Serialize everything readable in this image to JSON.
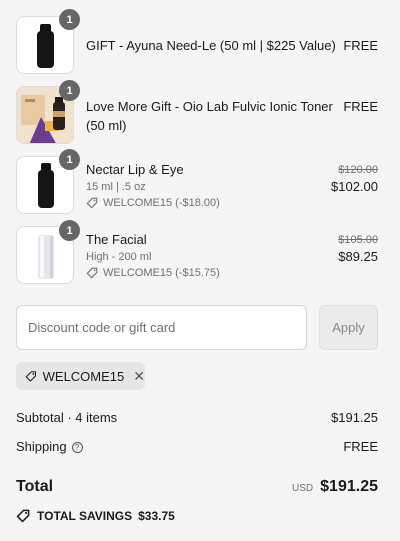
{
  "items": [
    {
      "qty": "1",
      "name": "GIFT - Ayuna Need-Le (50 ml | $225 Value)",
      "price": "FREE"
    },
    {
      "qty": "1",
      "name": "Love More Gift - Oio Lab Fulvic Ionic Toner",
      "name2": "(50 ml)",
      "price": "FREE"
    },
    {
      "qty": "1",
      "name": "Nectar Lip & Eye",
      "variant": "15 ml | .5 oz",
      "discount": "WELCOME15 (-$18.00)",
      "old_price": "$120.00",
      "price": "$102.00"
    },
    {
      "qty": "1",
      "name": "The Facial",
      "variant": "High - 200 ml",
      "discount": "WELCOME15 (-$15.75)",
      "old_price": "$105.00",
      "price": "$89.25"
    }
  ],
  "discount": {
    "placeholder": "Discount code or gift card",
    "apply_label": "Apply"
  },
  "applied_code": "WELCOME15",
  "summary": {
    "subtotal_label": "Subtotal · 4 items",
    "subtotal_value": "$191.25",
    "shipping_label": "Shipping",
    "shipping_value": "FREE",
    "total_label": "Total",
    "currency": "USD",
    "total_value": "$191.25",
    "savings_label": "TOTAL SAVINGS",
    "savings_value": "$33.75"
  }
}
